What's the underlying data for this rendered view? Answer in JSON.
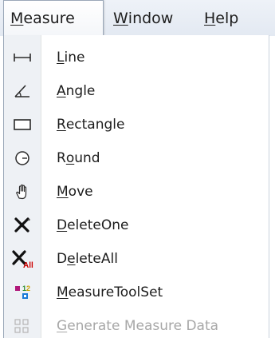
{
  "menubar": {
    "measure": {
      "first": "M",
      "rest": "easure"
    },
    "window": {
      "first": "W",
      "rest": "indow"
    },
    "help": {
      "first": "H",
      "rest": "elp"
    }
  },
  "menu": {
    "items": [
      {
        "pre": "",
        "acc": "L",
        "post": "ine",
        "icon": "line-icon",
        "enabled": true
      },
      {
        "pre": "",
        "acc": "A",
        "post": "ngle",
        "icon": "angle-icon",
        "enabled": true
      },
      {
        "pre": "",
        "acc": "R",
        "post": "ectangle",
        "icon": "rectangle-icon",
        "enabled": true
      },
      {
        "pre": "R",
        "acc": "o",
        "post": "und",
        "icon": "round-icon",
        "enabled": true
      },
      {
        "pre": "",
        "acc": "M",
        "post": "ove",
        "icon": "hand-icon",
        "enabled": true
      },
      {
        "pre": "",
        "acc": "D",
        "post": "eleteOne",
        "icon": "delete-one-icon",
        "enabled": true
      },
      {
        "pre": "D",
        "acc": "e",
        "post": "leteAll",
        "icon": "delete-all-icon",
        "enabled": true
      },
      {
        "pre": "",
        "acc": "M",
        "post": "easureToolSet",
        "icon": "tool-set-icon",
        "enabled": true
      },
      {
        "pre": "",
        "acc": "G",
        "post": "enerate Measure Data",
        "icon": "generate-data-icon",
        "enabled": false
      }
    ]
  },
  "colors": {
    "menubar_bg": "#e3e9f2",
    "gutter_bg": "#eef1f5",
    "text": "#1c1c1c",
    "disabled_text": "#a7a7a7",
    "delete_all_accent": "#cc0000"
  }
}
